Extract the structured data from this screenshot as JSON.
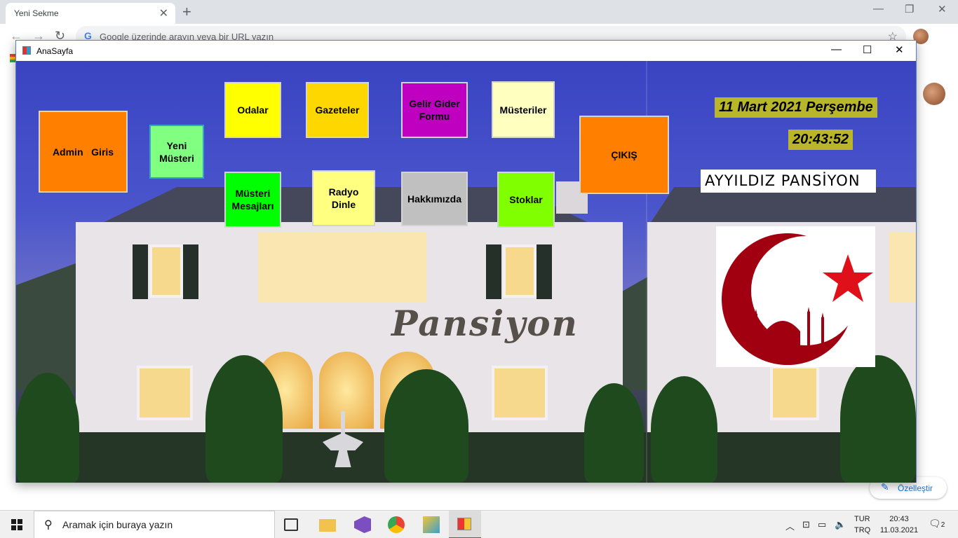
{
  "browser": {
    "tab_title": "Yeni Sekme",
    "tab_close": "✕",
    "new_tab": "+",
    "omnibox_placeholder": "Google üzerinde arayın veya bir URL yazın",
    "customize_label": "Özelleştir"
  },
  "window": {
    "title": "AnaSayfa",
    "minimize": "—",
    "maximize": "☐",
    "close": "✕"
  },
  "buttons": {
    "admin": "Admin   Giris",
    "new_customer": "Yeni Müsteri",
    "rooms": "Odalar",
    "newspapers": "Gazeteler",
    "income_expense": "Gelir Gider Formu",
    "customers": "Müsteriler",
    "exit": "ÇIKIŞ",
    "customer_messages": "Müsteri Mesajları",
    "radio": "Radyo Dinle",
    "about": "Hakkımızda",
    "stocks": "Stoklar"
  },
  "labels": {
    "date": "11 Mart 2021 Perşembe",
    "time": "20:43:52",
    "brand": "AYYILDIZ PANSİYON",
    "background_text": "Pansiyon"
  },
  "colors": {
    "admin": "#ff8000",
    "new_customer": "#80ff80",
    "rooms": "#ffff00",
    "newspapers": "#ffd700",
    "income_expense": "#c000c0",
    "customers": "#ffffc0",
    "exit": "#ff8000",
    "customer_messages": "#00ff00",
    "radio": "#ffff80",
    "about": "#c0c0c0",
    "stocks": "#80ff00",
    "clock_bg": "#b9b62a",
    "crescent": "#a00010",
    "star": "#e0101a"
  },
  "taskbar": {
    "search_placeholder": "Aramak için buraya yazın",
    "lang_1": "TUR",
    "lang_2": "TRQ",
    "time": "20:43",
    "date": "11.03.2021",
    "notification_count": "2"
  }
}
